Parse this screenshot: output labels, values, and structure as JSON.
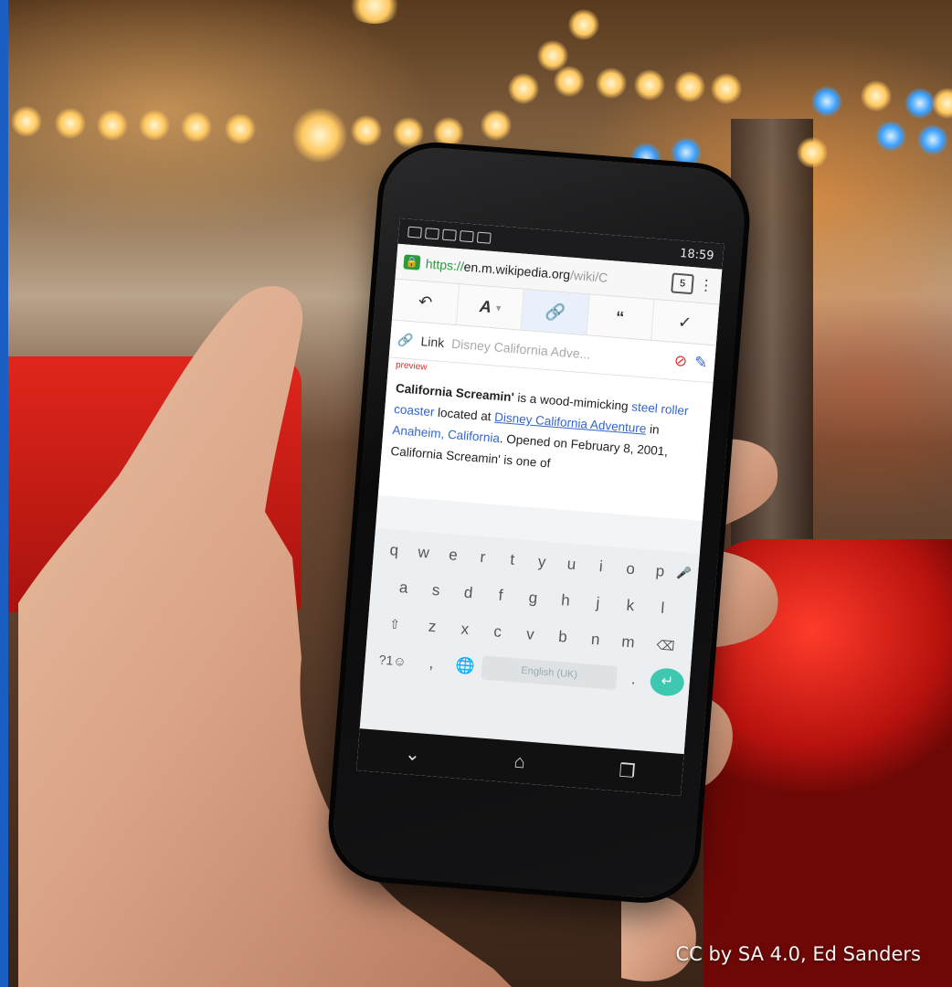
{
  "caption": "CC by SA 4.0, Ed Sanders",
  "status_bar": {
    "time": "18:59"
  },
  "browser": {
    "url_scheme": "https://",
    "url_host": "en.m.wikipedia.org",
    "url_path": "/wiki/C",
    "tab_count": "5"
  },
  "editor_toolbar": {
    "undo_icon": "undo-icon",
    "style_label": "A",
    "link_icon": "link-icon",
    "quote_label": "66",
    "done_icon": "checkmark-icon"
  },
  "link_inspector": {
    "label": "Link",
    "target": "Disney California Adve...",
    "preview_label": "preview"
  },
  "article": {
    "title_bold": "California Screamin'",
    "text1": " is a wood-mimicking ",
    "link1": "steel roller coaster",
    "text2": " located at ",
    "link2": "Disney California Adventure",
    "text3": " in ",
    "link3": "Anaheim, California",
    "text4": ". Opened on February 8, 2001, California Screamin' is one of"
  },
  "keyboard": {
    "row1": [
      "q",
      "w",
      "e",
      "r",
      "t",
      "y",
      "u",
      "i",
      "o",
      "p"
    ],
    "row2": [
      "a",
      "s",
      "d",
      "f",
      "g",
      "h",
      "j",
      "k",
      "l"
    ],
    "row3": [
      "z",
      "x",
      "c",
      "v",
      "b",
      "n",
      "m"
    ],
    "symbols_key": "?1☺",
    "comma_key": ",",
    "space_label": "English (UK)"
  }
}
